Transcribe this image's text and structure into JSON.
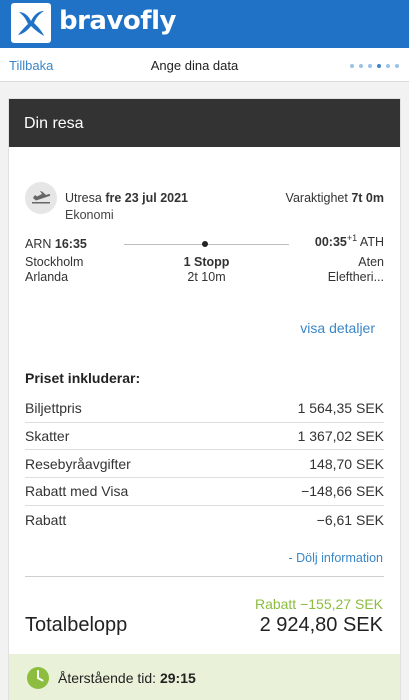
{
  "brand": {
    "name": "bravofly"
  },
  "nav": {
    "back_label": "Tillbaka",
    "title": "Ange dina data",
    "steps_total": 6,
    "step_current": 4
  },
  "trip": {
    "header": "Din resa",
    "direction_label": "Utresa",
    "date": "fre 23 jul 2021",
    "cabin_class": "Ekonomi",
    "duration_label": "Varaktighet",
    "duration_value": "7t 0m",
    "departure": {
      "code": "ARN",
      "time": "16:35",
      "city": "Stockholm",
      "airport": "Arlanda"
    },
    "arrival": {
      "code": "ATH",
      "time": "00:35",
      "day_offset": "+1",
      "city": "Aten",
      "airport": "Eleftheri..."
    },
    "stops": "1 Stopp",
    "stop_duration": "2t 10m",
    "details_link": "visa detaljer"
  },
  "price": {
    "heading": "Priset inkluderar:",
    "rows": [
      {
        "label": "Biljettpris",
        "value": "1 564,35 SEK"
      },
      {
        "label": "Skatter",
        "value": "1 367,02 SEK"
      },
      {
        "label": "Resebyråavgifter",
        "value": "148,70 SEK"
      },
      {
        "label": "Rabatt med Visa",
        "value": "−148,66 SEK"
      },
      {
        "label": "Rabatt",
        "value": "−6,61 SEK"
      }
    ],
    "hide_link": "- Dölj information",
    "discount_summary": "Rabatt −155,27 SEK",
    "total_label": "Totalbelopp",
    "total_value": "2 924,80 SEK"
  },
  "timer": {
    "label": "Återstående tid:",
    "value": "29:15"
  },
  "colors": {
    "brand_blue": "#1f72c6",
    "link_blue": "#3a86c8",
    "header_dark": "#333333",
    "discount_green": "#8cbd3f",
    "timer_bg": "#e9f2d9"
  },
  "icons": {
    "logo": "bravofly-logo-icon",
    "plane": "airplane-departure-icon",
    "clock": "clock-icon"
  }
}
